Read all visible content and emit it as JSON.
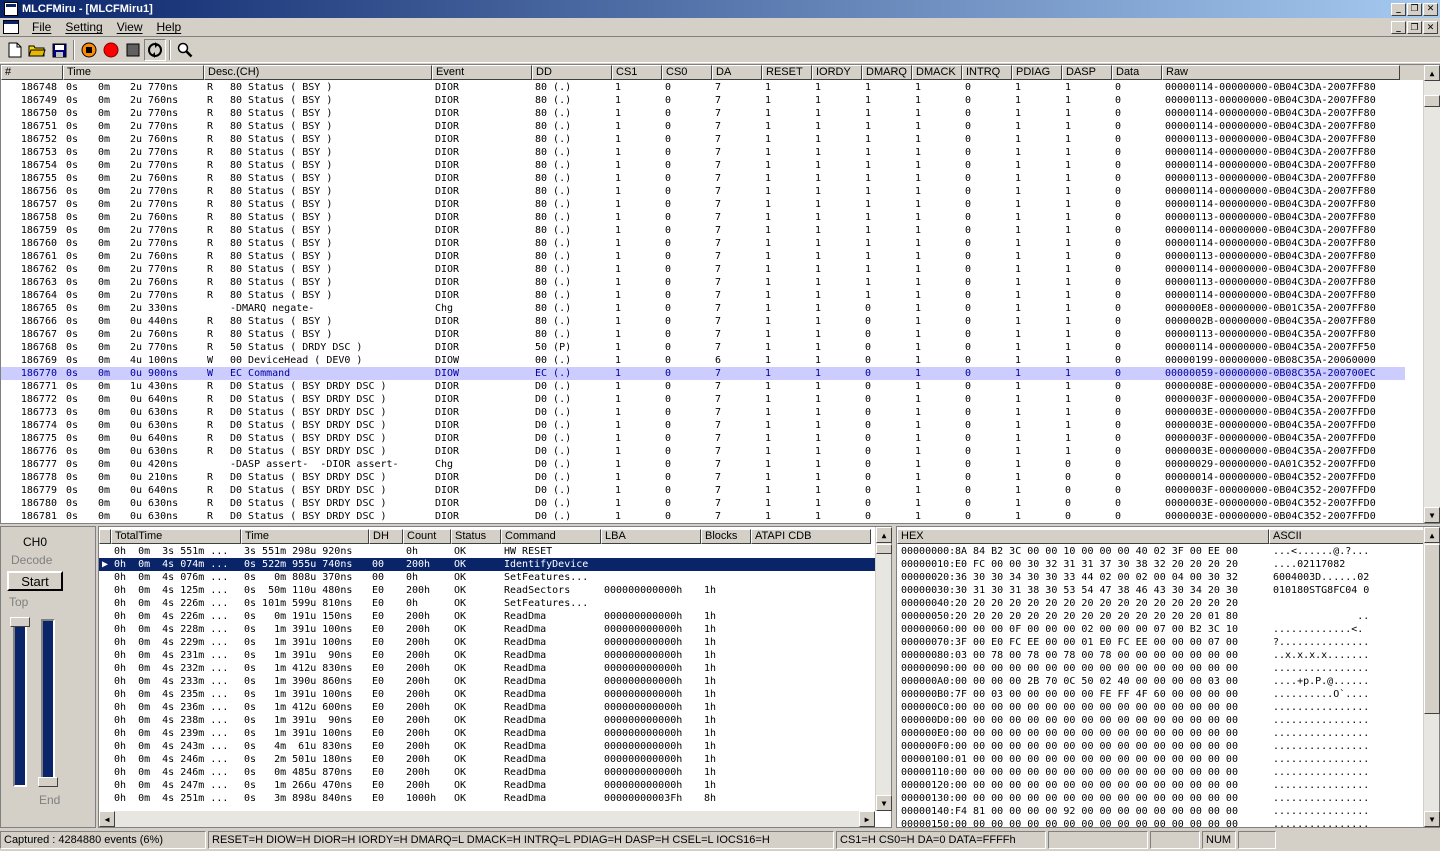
{
  "window": {
    "title": "MLCFMiru - [MLCFMiru1]"
  },
  "menu": [
    "File",
    "Setting",
    "View",
    "Help"
  ],
  "top_table": {
    "columns": [
      "#",
      "Time",
      "Desc.(CH)",
      "Event",
      "DD",
      "CS1",
      "CS0",
      "DA",
      "RESET",
      "IORDY",
      "DMARQ",
      "DMACK",
      "INTRQ",
      "PDIAG",
      "DASP",
      "Data",
      "Raw"
    ],
    "rows": [
      [
        "186748",
        "0s",
        "0m",
        "2u 770ns",
        "R",
        "80 Status ( BSY )",
        "DIOR",
        "80 (.)",
        "1",
        "0",
        "7",
        "1",
        "1",
        "1",
        "1",
        "0",
        "1",
        "1",
        "0",
        "00000114-00000000-0B04C3DA-2007FF80"
      ],
      [
        "186749",
        "0s",
        "0m",
        "2u 760ns",
        "R",
        "80 Status ( BSY )",
        "DIOR",
        "80 (.)",
        "1",
        "0",
        "7",
        "1",
        "1",
        "1",
        "1",
        "0",
        "1",
        "1",
        "0",
        "00000113-00000000-0B04C3DA-2007FF80"
      ],
      [
        "186750",
        "0s",
        "0m",
        "2u 770ns",
        "R",
        "80 Status ( BSY )",
        "DIOR",
        "80 (.)",
        "1",
        "0",
        "7",
        "1",
        "1",
        "1",
        "1",
        "0",
        "1",
        "1",
        "0",
        "00000114-00000000-0B04C3DA-2007FF80"
      ],
      [
        "186751",
        "0s",
        "0m",
        "2u 770ns",
        "R",
        "80 Status ( BSY )",
        "DIOR",
        "80 (.)",
        "1",
        "0",
        "7",
        "1",
        "1",
        "1",
        "1",
        "0",
        "1",
        "1",
        "0",
        "00000114-00000000-0B04C3DA-2007FF80"
      ],
      [
        "186752",
        "0s",
        "0m",
        "2u 760ns",
        "R",
        "80 Status ( BSY )",
        "DIOR",
        "80 (.)",
        "1",
        "0",
        "7",
        "1",
        "1",
        "1",
        "1",
        "0",
        "1",
        "1",
        "0",
        "00000113-00000000-0B04C3DA-2007FF80"
      ],
      [
        "186753",
        "0s",
        "0m",
        "2u 770ns",
        "R",
        "80 Status ( BSY )",
        "DIOR",
        "80 (.)",
        "1",
        "0",
        "7",
        "1",
        "1",
        "1",
        "1",
        "0",
        "1",
        "1",
        "0",
        "00000114-00000000-0B04C3DA-2007FF80"
      ],
      [
        "186754",
        "0s",
        "0m",
        "2u 770ns",
        "R",
        "80 Status ( BSY )",
        "DIOR",
        "80 (.)",
        "1",
        "0",
        "7",
        "1",
        "1",
        "1",
        "1",
        "0",
        "1",
        "1",
        "0",
        "00000114-00000000-0B04C3DA-2007FF80"
      ],
      [
        "186755",
        "0s",
        "0m",
        "2u 760ns",
        "R",
        "80 Status ( BSY )",
        "DIOR",
        "80 (.)",
        "1",
        "0",
        "7",
        "1",
        "1",
        "1",
        "1",
        "0",
        "1",
        "1",
        "0",
        "00000113-00000000-0B04C3DA-2007FF80"
      ],
      [
        "186756",
        "0s",
        "0m",
        "2u 770ns",
        "R",
        "80 Status ( BSY )",
        "DIOR",
        "80 (.)",
        "1",
        "0",
        "7",
        "1",
        "1",
        "1",
        "1",
        "0",
        "1",
        "1",
        "0",
        "00000114-00000000-0B04C3DA-2007FF80"
      ],
      [
        "186757",
        "0s",
        "0m",
        "2u 770ns",
        "R",
        "80 Status ( BSY )",
        "DIOR",
        "80 (.)",
        "1",
        "0",
        "7",
        "1",
        "1",
        "1",
        "1",
        "0",
        "1",
        "1",
        "0",
        "00000114-00000000-0B04C3DA-2007FF80"
      ],
      [
        "186758",
        "0s",
        "0m",
        "2u 760ns",
        "R",
        "80 Status ( BSY )",
        "DIOR",
        "80 (.)",
        "1",
        "0",
        "7",
        "1",
        "1",
        "1",
        "1",
        "0",
        "1",
        "1",
        "0",
        "00000113-00000000-0B04C3DA-2007FF80"
      ],
      [
        "186759",
        "0s",
        "0m",
        "2u 770ns",
        "R",
        "80 Status ( BSY )",
        "DIOR",
        "80 (.)",
        "1",
        "0",
        "7",
        "1",
        "1",
        "1",
        "1",
        "0",
        "1",
        "1",
        "0",
        "00000114-00000000-0B04C3DA-2007FF80"
      ],
      [
        "186760",
        "0s",
        "0m",
        "2u 770ns",
        "R",
        "80 Status ( BSY )",
        "DIOR",
        "80 (.)",
        "1",
        "0",
        "7",
        "1",
        "1",
        "1",
        "1",
        "0",
        "1",
        "1",
        "0",
        "00000114-00000000-0B04C3DA-2007FF80"
      ],
      [
        "186761",
        "0s",
        "0m",
        "2u 760ns",
        "R",
        "80 Status ( BSY )",
        "DIOR",
        "80 (.)",
        "1",
        "0",
        "7",
        "1",
        "1",
        "1",
        "1",
        "0",
        "1",
        "1",
        "0",
        "00000113-00000000-0B04C3DA-2007FF80"
      ],
      [
        "186762",
        "0s",
        "0m",
        "2u 770ns",
        "R",
        "80 Status ( BSY )",
        "DIOR",
        "80 (.)",
        "1",
        "0",
        "7",
        "1",
        "1",
        "1",
        "1",
        "0",
        "1",
        "1",
        "0",
        "00000114-00000000-0B04C3DA-2007FF80"
      ],
      [
        "186763",
        "0s",
        "0m",
        "2u 760ns",
        "R",
        "80 Status ( BSY )",
        "DIOR",
        "80 (.)",
        "1",
        "0",
        "7",
        "1",
        "1",
        "1",
        "1",
        "0",
        "1",
        "1",
        "0",
        "00000113-00000000-0B04C3DA-2007FF80"
      ],
      [
        "186764",
        "0s",
        "0m",
        "2u 770ns",
        "R",
        "80 Status ( BSY )",
        "DIOR",
        "80 (.)",
        "1",
        "0",
        "7",
        "1",
        "1",
        "1",
        "1",
        "0",
        "1",
        "1",
        "0",
        "00000114-00000000-0B04C3DA-2007FF80"
      ],
      [
        "186765",
        "0s",
        "0m",
        "2u 330ns",
        "",
        "-DMARQ negate-",
        "Chg",
        "80 (.)",
        "1",
        "0",
        "7",
        "1",
        "1",
        "0",
        "1",
        "0",
        "1",
        "1",
        "0",
        "000000E8-00000000-0B01C35A-2007FF80"
      ],
      [
        "186766",
        "0s",
        "0m",
        "0u 440ns",
        "R",
        "80 Status ( BSY )",
        "DIOR",
        "80 (.)",
        "1",
        "0",
        "7",
        "1",
        "1",
        "0",
        "1",
        "0",
        "1",
        "1",
        "0",
        "0000002B-00000000-0B04C35A-2007FF80"
      ],
      [
        "186767",
        "0s",
        "0m",
        "2u 760ns",
        "R",
        "80 Status ( BSY )",
        "DIOR",
        "80 (.)",
        "1",
        "0",
        "7",
        "1",
        "1",
        "0",
        "1",
        "0",
        "1",
        "1",
        "0",
        "00000113-00000000-0B04C35A-2007FF80"
      ],
      [
        "186768",
        "0s",
        "0m",
        "2u 770ns",
        "R",
        "50 Status ( DRDY DSC )",
        "DIOR",
        "50 (P)",
        "1",
        "0",
        "7",
        "1",
        "1",
        "0",
        "1",
        "0",
        "1",
        "1",
        "0",
        "00000114-00000000-0B04C35A-2007FF50"
      ],
      [
        "186769",
        "0s",
        "0m",
        "4u 100ns",
        "W",
        "00 DeviceHead ( DEV0 )",
        "DIOW",
        "00 (.)",
        "1",
        "0",
        "6",
        "1",
        "1",
        "0",
        "1",
        "0",
        "1",
        "1",
        "0",
        "00000199-00000000-0B08C35A-20060000"
      ],
      [
        "186770",
        "0s",
        "0m",
        "0u 900ns",
        "W",
        "EC Command",
        "DIOW",
        "EC (.)",
        "1",
        "0",
        "7",
        "1",
        "1",
        "0",
        "1",
        "0",
        "1",
        "1",
        "0",
        "00000059-00000000-0B08C35A-200700EC"
      ],
      [
        "186771",
        "0s",
        "0m",
        "1u 430ns",
        "R",
        "D0 Status ( BSY DRDY DSC )",
        "DIOR",
        "D0 (.)",
        "1",
        "0",
        "7",
        "1",
        "1",
        "0",
        "1",
        "0",
        "1",
        "1",
        "0",
        "0000008E-00000000-0B04C35A-2007FFD0"
      ],
      [
        "186772",
        "0s",
        "0m",
        "0u 640ns",
        "R",
        "D0 Status ( BSY DRDY DSC )",
        "DIOR",
        "D0 (.)",
        "1",
        "0",
        "7",
        "1",
        "1",
        "0",
        "1",
        "0",
        "1",
        "1",
        "0",
        "0000003F-00000000-0B04C35A-2007FFD0"
      ],
      [
        "186773",
        "0s",
        "0m",
        "0u 630ns",
        "R",
        "D0 Status ( BSY DRDY DSC )",
        "DIOR",
        "D0 (.)",
        "1",
        "0",
        "7",
        "1",
        "1",
        "0",
        "1",
        "0",
        "1",
        "1",
        "0",
        "0000003E-00000000-0B04C35A-2007FFD0"
      ],
      [
        "186774",
        "0s",
        "0m",
        "0u 630ns",
        "R",
        "D0 Status ( BSY DRDY DSC )",
        "DIOR",
        "D0 (.)",
        "1",
        "0",
        "7",
        "1",
        "1",
        "0",
        "1",
        "0",
        "1",
        "1",
        "0",
        "0000003E-00000000-0B04C35A-2007FFD0"
      ],
      [
        "186775",
        "0s",
        "0m",
        "0u 640ns",
        "R",
        "D0 Status ( BSY DRDY DSC )",
        "DIOR",
        "D0 (.)",
        "1",
        "0",
        "7",
        "1",
        "1",
        "0",
        "1",
        "0",
        "1",
        "1",
        "0",
        "0000003F-00000000-0B04C35A-2007FFD0"
      ],
      [
        "186776",
        "0s",
        "0m",
        "0u 630ns",
        "R",
        "D0 Status ( BSY DRDY DSC )",
        "DIOR",
        "D0 (.)",
        "1",
        "0",
        "7",
        "1",
        "1",
        "0",
        "1",
        "0",
        "1",
        "1",
        "0",
        "0000003E-00000000-0B04C35A-2007FFD0"
      ],
      [
        "186777",
        "0s",
        "0m",
        "0u 420ns",
        "",
        "-DASP assert-  -DIOR assert-",
        "Chg",
        "D0 (.)",
        "1",
        "0",
        "7",
        "1",
        "1",
        "0",
        "1",
        "0",
        "1",
        "0",
        "0",
        "00000029-00000000-0A01C352-2007FFD0"
      ],
      [
        "186778",
        "0s",
        "0m",
        "0u 210ns",
        "R",
        "D0 Status ( BSY DRDY DSC )",
        "DIOR",
        "D0 (.)",
        "1",
        "0",
        "7",
        "1",
        "1",
        "0",
        "1",
        "0",
        "1",
        "0",
        "0",
        "00000014-00000000-0B04C352-2007FFD0"
      ],
      [
        "186779",
        "0s",
        "0m",
        "0u 640ns",
        "R",
        "D0 Status ( BSY DRDY DSC )",
        "DIOR",
        "D0 (.)",
        "1",
        "0",
        "7",
        "1",
        "1",
        "0",
        "1",
        "0",
        "1",
        "0",
        "0",
        "0000003F-00000000-0B04C352-2007FFD0"
      ],
      [
        "186780",
        "0s",
        "0m",
        "0u 630ns",
        "R",
        "D0 Status ( BSY DRDY DSC )",
        "DIOR",
        "D0 (.)",
        "1",
        "0",
        "7",
        "1",
        "1",
        "0",
        "1",
        "0",
        "1",
        "0",
        "0",
        "0000003E-00000000-0B04C352-2007FFD0"
      ],
      [
        "186781",
        "0s",
        "0m",
        "0u 630ns",
        "R",
        "D0 Status ( BSY DRDY DSC )",
        "DIOR",
        "D0 (.)",
        "1",
        "0",
        "7",
        "1",
        "1",
        "0",
        "1",
        "0",
        "1",
        "0",
        "0",
        "0000003E-00000000-0B04C352-2007FFD0"
      ]
    ],
    "selected_row": "186770"
  },
  "control": {
    "channel": "CH0",
    "decode_label": "Decode",
    "start_label": "Start",
    "top_label": "Top",
    "end_label": "End"
  },
  "cmd_table": {
    "columns": [
      "",
      "TotalTime",
      "Time",
      "DH",
      "Count",
      "Status",
      "Command",
      "LBA",
      "Blocks",
      "ATAPI CDB"
    ],
    "rows": [
      [
        "",
        "0h  0m  3s 551m ...",
        "3s 551m 298u 920ns",
        "",
        "0h",
        "OK",
        "HW RESET",
        "",
        "",
        ""
      ],
      [
        "▶",
        "0h  0m  4s 074m ...",
        "0s 522m 955u 740ns",
        "00",
        "200h",
        "OK",
        "IdentifyDevice",
        "",
        "",
        ""
      ],
      [
        "",
        "0h  0m  4s 076m ...",
        "0s   0m 808u 370ns",
        "00",
        "0h",
        "OK",
        "SetFeatures...",
        "",
        "",
        ""
      ],
      [
        "",
        "0h  0m  4s 125m ...",
        "0s  50m 110u 480ns",
        "E0",
        "200h",
        "OK",
        "ReadSectors",
        "000000000000h",
        "1h",
        ""
      ],
      [
        "",
        "0h  0m  4s 226m ...",
        "0s 101m 599u 810ns",
        "E0",
        "0h",
        "OK",
        "SetFeatures...",
        "",
        "",
        ""
      ],
      [
        "",
        "0h  0m  4s 226m ...",
        "0s   0m 191u 150ns",
        "E0",
        "200h",
        "OK",
        "ReadDma",
        "000000000000h",
        "1h",
        ""
      ],
      [
        "",
        "0h  0m  4s 228m ...",
        "0s   1m 391u 100ns",
        "E0",
        "200h",
        "OK",
        "ReadDma",
        "000000000000h",
        "1h",
        ""
      ],
      [
        "",
        "0h  0m  4s 229m ...",
        "0s   1m 391u 100ns",
        "E0",
        "200h",
        "OK",
        "ReadDma",
        "000000000000h",
        "1h",
        ""
      ],
      [
        "",
        "0h  0m  4s 231m ...",
        "0s   1m 391u  90ns",
        "E0",
        "200h",
        "OK",
        "ReadDma",
        "000000000000h",
        "1h",
        ""
      ],
      [
        "",
        "0h  0m  4s 232m ...",
        "0s   1m 412u 830ns",
        "E0",
        "200h",
        "OK",
        "ReadDma",
        "000000000000h",
        "1h",
        ""
      ],
      [
        "",
        "0h  0m  4s 233m ...",
        "0s   1m 390u 860ns",
        "E0",
        "200h",
        "OK",
        "ReadDma",
        "000000000000h",
        "1h",
        ""
      ],
      [
        "",
        "0h  0m  4s 235m ...",
        "0s   1m 391u 100ns",
        "E0",
        "200h",
        "OK",
        "ReadDma",
        "000000000000h",
        "1h",
        ""
      ],
      [
        "",
        "0h  0m  4s 236m ...",
        "0s   1m 412u 600ns",
        "E0",
        "200h",
        "OK",
        "ReadDma",
        "000000000000h",
        "1h",
        ""
      ],
      [
        "",
        "0h  0m  4s 238m ...",
        "0s   1m 391u  90ns",
        "E0",
        "200h",
        "OK",
        "ReadDma",
        "000000000000h",
        "1h",
        ""
      ],
      [
        "",
        "0h  0m  4s 239m ...",
        "0s   1m 391u 100ns",
        "E0",
        "200h",
        "OK",
        "ReadDma",
        "000000000000h",
        "1h",
        ""
      ],
      [
        "",
        "0h  0m  4s 243m ...",
        "0s   4m  61u 830ns",
        "E0",
        "200h",
        "OK",
        "ReadDma",
        "000000000000h",
        "1h",
        ""
      ],
      [
        "",
        "0h  0m  4s 246m ...",
        "0s   2m 501u 180ns",
        "E0",
        "200h",
        "OK",
        "ReadDma",
        "000000000000h",
        "1h",
        ""
      ],
      [
        "",
        "0h  0m  4s 246m ...",
        "0s   0m 485u 870ns",
        "E0",
        "200h",
        "OK",
        "ReadDma",
        "000000000000h",
        "1h",
        ""
      ],
      [
        "",
        "0h  0m  4s 247m ...",
        "0s   1m 266u 470ns",
        "E0",
        "200h",
        "OK",
        "ReadDma",
        "000000000000h",
        "1h",
        ""
      ],
      [
        "",
        "0h  0m  4s 251m ...",
        "0s   3m 898u 840ns",
        "E0",
        "1000h",
        "OK",
        "ReadDma",
        "00000000003Fh",
        "8h",
        ""
      ]
    ],
    "selected_index": 1
  },
  "hex": {
    "columns": [
      "HEX",
      "ASCII"
    ],
    "rows": [
      [
        "00000000:",
        "8A 84 B2 3C 00 00 10 00 00 00 40 02 3F 00 EE 00",
        "...<......@.?..."
      ],
      [
        "00000010:",
        "E0 FC 00 00 30 32 31 31 37 30 38 32 20 20 20 20",
        "....02117082    "
      ],
      [
        "00000020:",
        "36 30 30 34 30 30 33 44 02 00 02 00 04 00 30 32",
        "6004003D......02"
      ],
      [
        "00000030:",
        "30 31 30 31 38 30 53 54 47 38 46 43 30 34 20 30",
        "010180STG8FC04 0"
      ],
      [
        "00000040:",
        "20 20 20 20 20 20 20 20 20 20 20 20 20 20 20 20",
        "                "
      ],
      [
        "00000050:",
        "20 20 20 20 20 20 20 20 20 20 20 20 20 20 01 80",
        "              .."
      ],
      [
        "00000060:",
        "00 00 00 0F 00 00 00 02 00 00 00 07 00 B2 3C 10",
        ".............<."
      ],
      [
        "00000070:",
        "3F 00 E0 FC EE 00 00 01 E0 FC EE 00 00 00 07 00",
        "?..............."
      ],
      [
        "00000080:",
        "03 00 78 00 78 00 78 00 78 00 00 00 00 00 00 00",
        "..x.x.x.x......."
      ],
      [
        "00000090:",
        "00 00 00 00 00 00 00 00 00 00 00 00 00 00 00 00",
        "................"
      ],
      [
        "000000A0:",
        "00 00 00 00 2B 70 0C 50 02 40 00 00 00 00 03 00",
        "....+p.P.@......"
      ],
      [
        "000000B0:",
        "7F 00 03 00 00 00 00 00 FE FF 4F 60 00 00 00 00",
        "..........O`...."
      ],
      [
        "000000C0:",
        "00 00 00 00 00 00 00 00 00 00 00 00 00 00 00 00",
        "................"
      ],
      [
        "000000D0:",
        "00 00 00 00 00 00 00 00 00 00 00 00 00 00 00 00",
        "................"
      ],
      [
        "000000E0:",
        "00 00 00 00 00 00 00 00 00 00 00 00 00 00 00 00",
        "................"
      ],
      [
        "000000F0:",
        "00 00 00 00 00 00 00 00 00 00 00 00 00 00 00 00",
        "................"
      ],
      [
        "00000100:",
        "01 00 00 00 00 00 00 00 00 00 00 00 00 00 00 00",
        "................"
      ],
      [
        "00000110:",
        "00 00 00 00 00 00 00 00 00 00 00 00 00 00 00 00",
        "................"
      ],
      [
        "00000120:",
        "00 00 00 00 00 00 00 00 00 00 00 00 00 00 00 00",
        "................"
      ],
      [
        "00000130:",
        "00 00 00 00 00 00 00 00 00 00 00 00 00 00 00 00",
        "................"
      ],
      [
        "00000140:",
        "F4 81 00 00 00 00 92 00 00 00 00 00 00 00 00 00",
        "................"
      ],
      [
        "00000150:",
        "00 00 00 00 00 00 00 00 00 00 00 00 00 00 00 00",
        "................"
      ]
    ]
  },
  "status": {
    "captured": "Captured : 4284880 events (6%)",
    "signals": "RESET=H  DIOW=H  DIOR=H  IORDY=H  DMARQ=L  DMACK=H  INTRQ=L  PDIAG=H  DASP=H  CSEL=L  IOCS16=H",
    "chipsel": "CS1=H  CS0=H  DA=0  DATA=FFFFh",
    "num": "NUM"
  }
}
